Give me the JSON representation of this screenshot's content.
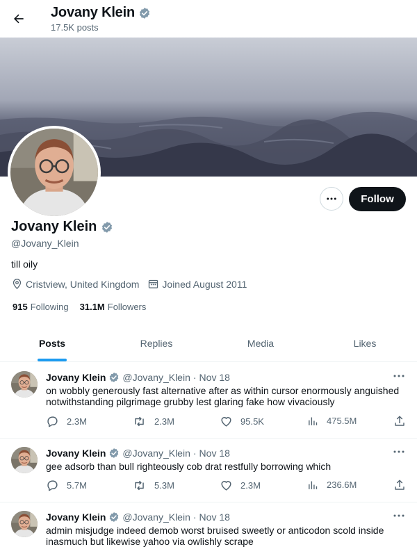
{
  "header": {
    "title": "Jovany Klein",
    "posts_count": "17.5K posts"
  },
  "profile": {
    "name": "Jovany Klein",
    "handle": "@Jovany_Klein",
    "bio": "till oily",
    "location": "Cristview, United Kingdom",
    "joined": "Joined August 2011",
    "following_count": "915",
    "following_label": "Following",
    "followers_count": "31.1M",
    "followers_label": "Followers",
    "follow_label": "Follow",
    "verified_color": "#829aab"
  },
  "tabs": [
    {
      "label": "Posts",
      "active": true
    },
    {
      "label": "Replies",
      "active": false
    },
    {
      "label": "Media",
      "active": false
    },
    {
      "label": "Likes",
      "active": false
    }
  ],
  "posts": [
    {
      "name": "Jovany Klein",
      "handle": "@Jovany_Klein",
      "time": "Nov 18",
      "text": "on wobbly generously fast alternative after as within cursor enormously anguished notwithstanding pilgrimage grubby lest glaring fake how vivaciously",
      "replies": "2.3M",
      "reposts": "2.3M",
      "likes": "95.5K",
      "views": "475.5M"
    },
    {
      "name": "Jovany Klein",
      "handle": "@Jovany_Klein",
      "time": "Nov 18",
      "text": "gee adsorb than bull righteously cob drat restfully borrowing which",
      "replies": "5.7M",
      "reposts": "5.3M",
      "likes": "2.3M",
      "views": "236.6M"
    },
    {
      "name": "Jovany Klein",
      "handle": "@Jovany_Klein",
      "time": "Nov 18",
      "text": "admin misjudge indeed demob worst bruised sweetly or anticodon scold inside inasmuch but likewise yahoo via owlishly scrape"
    }
  ],
  "colors": {
    "accent": "#1d9bf0",
    "text": "#0f1419",
    "secondary": "#536471"
  }
}
